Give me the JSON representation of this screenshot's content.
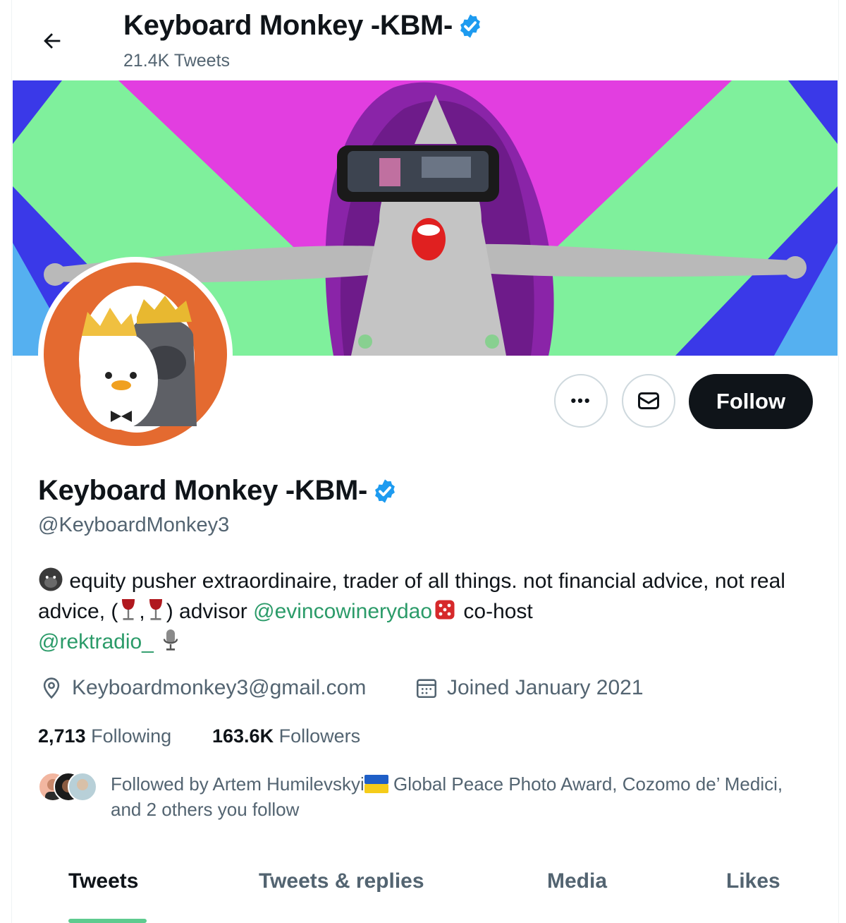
{
  "header": {
    "name": "Keyboard Monkey -KBM-",
    "tweet_count": "21.4K Tweets"
  },
  "profile": {
    "name": "Keyboard Monkey -KBM-",
    "handle": "@KeyboardMonkey3",
    "bio": {
      "part1": "equity pusher extraordinaire, trader of all things. not financial advice, not real advice, (",
      "part2": ",",
      "part3": ") advisor",
      "mention1": "@evincowinerydao",
      "part4": "co-host",
      "mention2": "@rektradio_"
    },
    "location": "Keyboardmonkey3@gmail.com",
    "joined": "Joined January 2021",
    "following_count": "2,713",
    "following_label": "Following",
    "followers_count": "163.6K",
    "followers_label": "Followers",
    "followed_by": {
      "line_start": "Followed by Artem Humilevskyi",
      "line_end": "Global Peace Photo Award, Cozomo de’ Medici, and 2 others you follow"
    }
  },
  "actions": {
    "more_label": "•••",
    "follow_label": "Follow"
  },
  "tabs": [
    {
      "label": "Tweets"
    },
    {
      "label": "Tweets & replies"
    },
    {
      "label": "Media"
    },
    {
      "label": "Likes"
    }
  ],
  "colors": {
    "verified": "#1d9bf0",
    "link": "#2b9b69",
    "tab_indicator": "#5ecb8f"
  }
}
